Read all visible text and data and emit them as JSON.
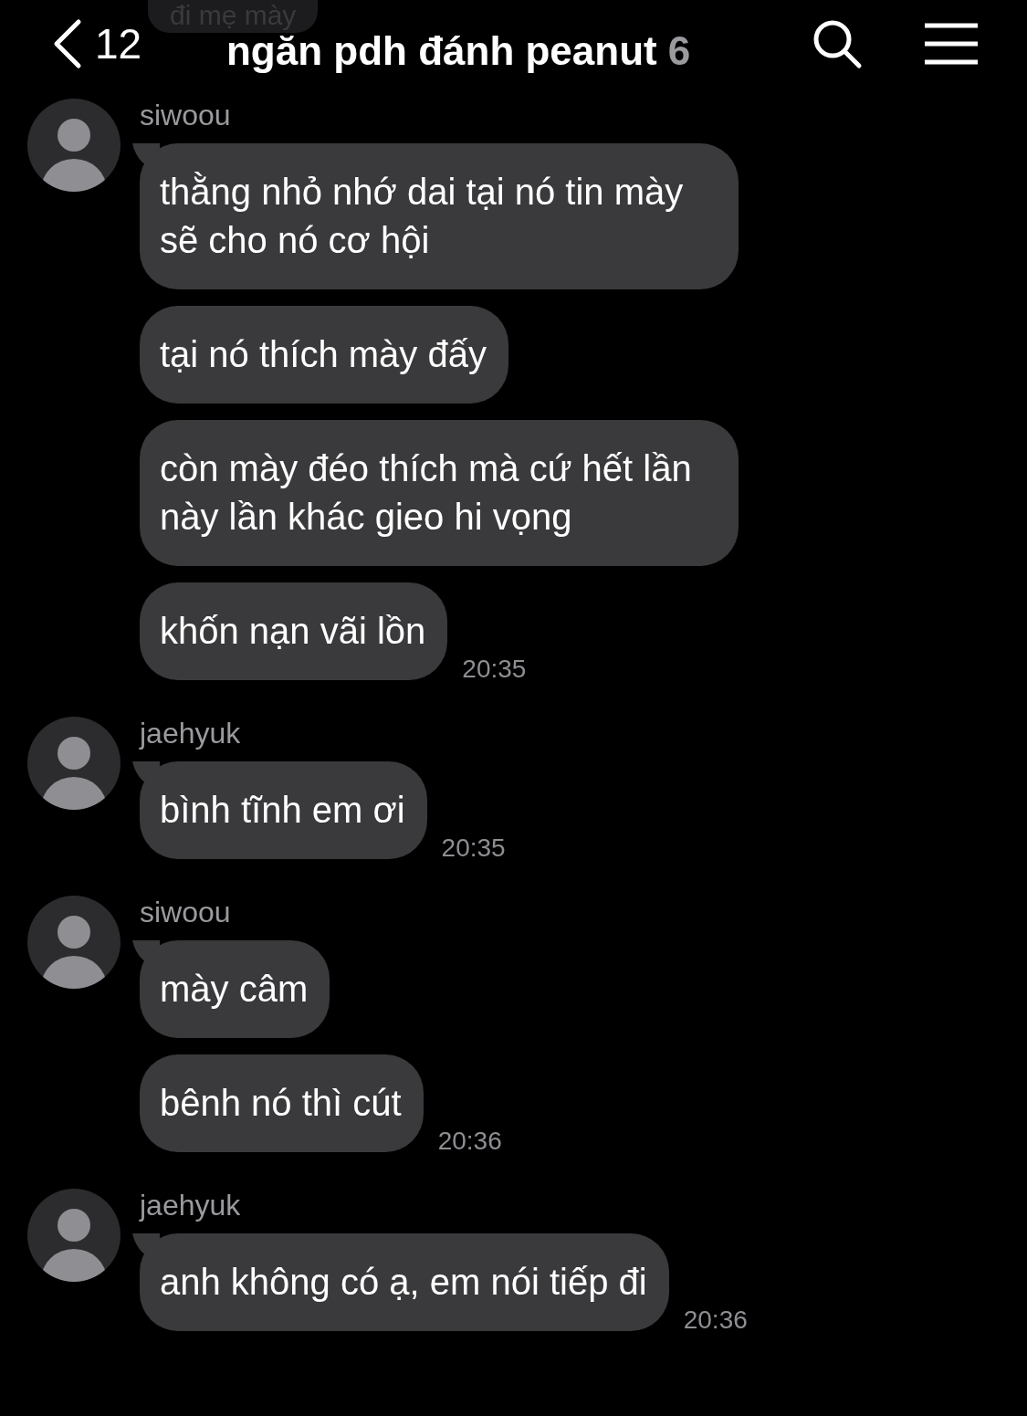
{
  "header": {
    "back_count": "12",
    "title": "ngăn pdh đánh peanut",
    "member_count": "6"
  },
  "partial_message": "đi mẹ mày",
  "groups": [
    {
      "sender": "siwoou",
      "messages": [
        "thằng nhỏ nhớ dai tại nó tin mày sẽ cho nó cơ hội",
        "tại nó thích mày đấy",
        "còn mày đéo thích mà cứ hết lần này lần khác gieo hi vọng",
        "khốn nạn vãi lồn"
      ],
      "time": "20:35"
    },
    {
      "sender": "jaehyuk",
      "messages": [
        "bình tĩnh em ơi"
      ],
      "time": "20:35"
    },
    {
      "sender": "siwoou",
      "messages": [
        "mày câm",
        "bênh nó thì cút"
      ],
      "time": "20:36"
    },
    {
      "sender": "jaehyuk",
      "messages": [
        "anh không có ạ, em nói tiếp đi"
      ],
      "time": "20:36"
    }
  ]
}
